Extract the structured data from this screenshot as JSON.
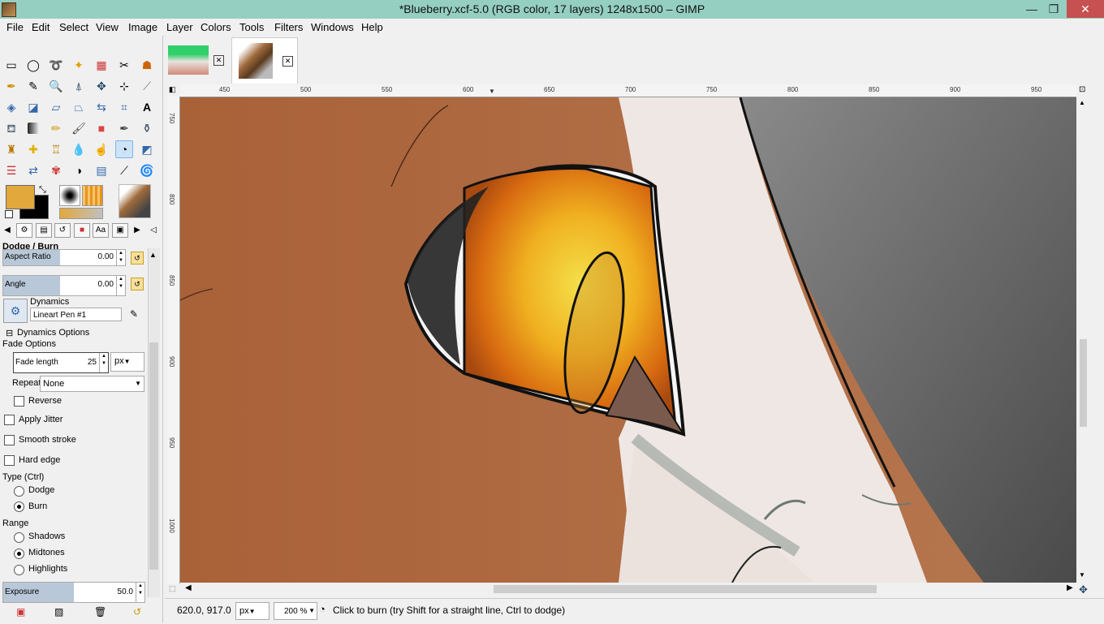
{
  "window": {
    "title": "*Blueberry.xcf-5.0 (RGB color, 17 layers) 1248x1500 – GIMP",
    "minimize": "—",
    "restore": "❐",
    "close": "✕"
  },
  "menu": [
    "File",
    "Edit",
    "Select",
    "View",
    "Image",
    "Layer",
    "Colors",
    "Tools",
    "Filters",
    "Windows",
    "Help"
  ],
  "tool_options": {
    "title": "Dodge / Burn",
    "aspect_ratio": {
      "label": "Aspect Ratio",
      "value": "0.00"
    },
    "angle": {
      "label": "Angle",
      "value": "0.00"
    },
    "dynamics": {
      "label": "Dynamics",
      "value": "Lineart Pen #1"
    },
    "dynamics_options": "Dynamics Options",
    "fade_options": "Fade Options",
    "fade_length": {
      "label": "Fade length",
      "value": "25",
      "unit": "px"
    },
    "repeat": {
      "label": "Repeat:",
      "value": "None"
    },
    "reverse": "Reverse",
    "apply_jitter": "Apply Jitter",
    "smooth_stroke": "Smooth stroke",
    "hard_edge": "Hard edge",
    "type_label": "Type  (Ctrl)",
    "type_dodge": "Dodge",
    "type_burn": "Burn",
    "range_label": "Range",
    "range_shadows": "Shadows",
    "range_midtones": "Midtones",
    "range_highlights": "Highlights",
    "exposure": {
      "label": "Exposure",
      "value": "50.0",
      "fraction": 0.5
    }
  },
  "colors": {
    "foreground": "#e2a83c",
    "background": "#000000",
    "accent": "#7eb4ea"
  },
  "ruler_top": [
    "450",
    "500",
    "550",
    "600",
    "650",
    "700",
    "750",
    "800",
    "850",
    "900",
    "950"
  ],
  "ruler_left": [
    "750",
    "800",
    "850",
    "900",
    "950",
    "1000"
  ],
  "status": {
    "coords": "620.0, 917.0",
    "unit": "px",
    "zoom": "200 %",
    "message": "Click to burn (try Shift for a straight line, Ctrl to dodge)"
  }
}
